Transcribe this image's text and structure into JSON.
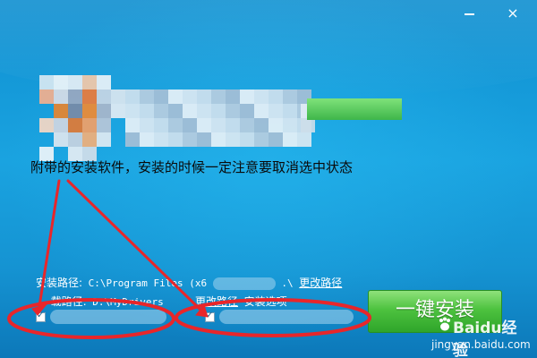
{
  "window": {
    "minimize_icon": "minimize-icon",
    "close_icon": "close-icon",
    "close_glyph": "×"
  },
  "annotation_text": "附带的安装软件，安装的时候一定注意要取消选中状态",
  "install_path": {
    "label": "安装路径:",
    "value_visible_start": "C:\\Program Files (x6",
    "value_visible_end": ".\\",
    "change_link": "更改路径"
  },
  "driver_path": {
    "label": "载路径:",
    "value_visible": "D:\\MyDrivers",
    "change_link": "更改路径",
    "options_link": "安装选项"
  },
  "options": [
    {
      "checked": true
    },
    {
      "checked": true
    }
  ],
  "install_button": {
    "label": "一键安装"
  },
  "watermark": {
    "brand": "Baidu经验",
    "url": "jingyan.baidu.com"
  },
  "colors": {
    "window_blue": "#1aa3e0",
    "button_green": "#4dc23f",
    "annotation_red": "#e8262a"
  }
}
